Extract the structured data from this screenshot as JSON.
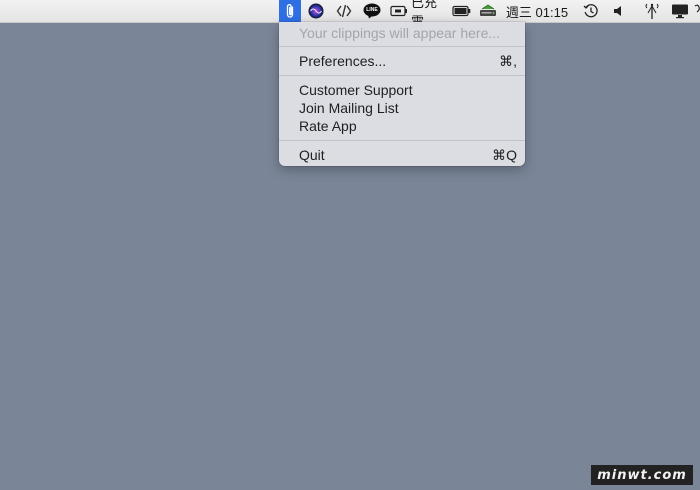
{
  "menubar": {
    "icons": {
      "clip": "paperclip-icon",
      "siri": "siri-icon",
      "dev": "code-angle-icon",
      "line": "line-app-icon",
      "battery_slot": "battery-charging-icon",
      "battery": "battery-icon",
      "drive": "drive-icon",
      "time_machine": "time-machine-icon",
      "volume": "volume-icon",
      "antenna": "signal-icon",
      "display": "display-icon"
    },
    "line_label": "LINE",
    "charging_text": "已充電",
    "clock": "週三 01:15",
    "accent_color": "#2f6fe4"
  },
  "dropdown": {
    "placeholder": "Your clippings will appear here...",
    "preferences_label": "Preferences...",
    "preferences_shortcut": "⌘,",
    "customer_support": "Customer Support",
    "join_mailing_list": "Join Mailing List",
    "rate_app": "Rate App",
    "quit_label": "Quit",
    "quit_shortcut": "⌘Q"
  },
  "watermark": "minwt.com"
}
